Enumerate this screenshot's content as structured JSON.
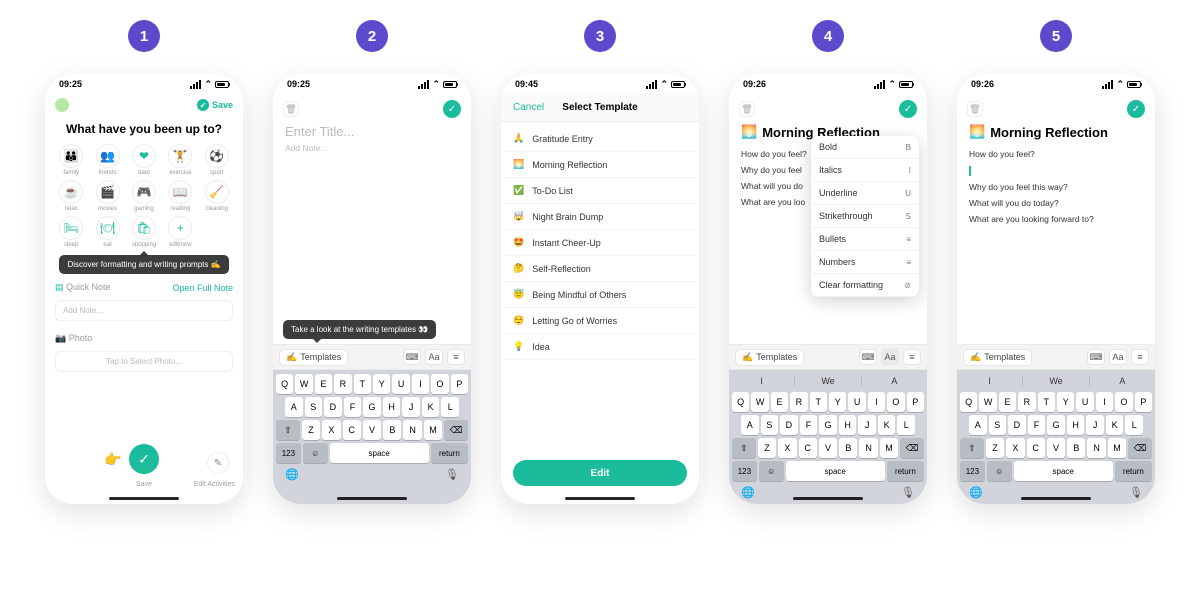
{
  "badges": [
    "1",
    "2",
    "3",
    "4",
    "5"
  ],
  "status": {
    "t1": "09:25",
    "t2": "09:25",
    "t3": "09:45",
    "t4": "09:26",
    "t5": "09:26"
  },
  "s1": {
    "save": "Save",
    "heading": "What have you been up to?",
    "activities": [
      {
        "name": "family",
        "icon": "👪"
      },
      {
        "name": "friends",
        "icon": "👥"
      },
      {
        "name": "date",
        "icon": "❤"
      },
      {
        "name": "exercise",
        "icon": "🏋"
      },
      {
        "name": "sport",
        "icon": "⚽"
      },
      {
        "name": "relax",
        "icon": "☕"
      },
      {
        "name": "movies",
        "icon": "🎬"
      },
      {
        "name": "gaming",
        "icon": "🎮"
      },
      {
        "name": "reading",
        "icon": "📖"
      },
      {
        "name": "cleaning",
        "icon": "🧹"
      },
      {
        "name": "sleep",
        "icon": "🛏"
      },
      {
        "name": "eat",
        "icon": "🍽"
      },
      {
        "name": "shopping",
        "icon": "🛍"
      },
      {
        "name": "edit/new",
        "icon": "+"
      }
    ],
    "tooltip": "Discover formatting and writing prompts ✍️",
    "quicknote": "Quick Note",
    "openfull": "Open Full Note",
    "addnote": "Add Note...",
    "photo": "Photo",
    "tapphoto": "Tap to Select Photo...",
    "savelbl": "Save",
    "editact": "Edit Activities"
  },
  "s2": {
    "title_ph": "Enter Title...",
    "body_ph": "Add Note...",
    "templates": "Templates",
    "tooltip": "Take a look at the writing templates 👀",
    "keyboard": {
      "row1": [
        "Q",
        "W",
        "E",
        "R",
        "T",
        "Y",
        "U",
        "I",
        "O",
        "P"
      ],
      "row2": [
        "A",
        "S",
        "D",
        "F",
        "G",
        "H",
        "J",
        "K",
        "L"
      ],
      "row3": [
        "Z",
        "X",
        "C",
        "V",
        "B",
        "N",
        "M"
      ],
      "k123": "123",
      "space": "space",
      "return": "return"
    }
  },
  "s3": {
    "cancel": "Cancel",
    "title": "Select Template",
    "items": [
      {
        "e": "🙏",
        "t": "Gratitude Entry"
      },
      {
        "e": "🌅",
        "t": "Morning Reflection"
      },
      {
        "e": "✅",
        "t": "To-Do List"
      },
      {
        "e": "🤯",
        "t": "Night Brain Dump"
      },
      {
        "e": "🤩",
        "t": "Instant Cheer-Up"
      },
      {
        "e": "🤔",
        "t": "Self-Reflection"
      },
      {
        "e": "😇",
        "t": "Being Mindful of Others"
      },
      {
        "e": "😌",
        "t": "Letting Go of Worries"
      },
      {
        "e": "💡",
        "t": "Idea"
      }
    ],
    "edit": "Edit"
  },
  "s4": {
    "title": "Morning Reflection",
    "emoji": "🌅",
    "prompts": [
      "How do you feel?",
      "Why do you feel",
      "What will you do",
      "What are you loo"
    ],
    "templates": "Templates",
    "menu": [
      {
        "l": "Bold",
        "s": "B"
      },
      {
        "l": "Italics",
        "s": "I"
      },
      {
        "l": "Underline",
        "s": "U"
      },
      {
        "l": "Strikethrough",
        "s": "S"
      },
      {
        "l": "Bullets",
        "s": "≡"
      },
      {
        "l": "Numbers",
        "s": "≡"
      },
      {
        "l": "Clear formatting",
        "s": "⊘"
      }
    ],
    "sug": [
      "I",
      "We",
      "A"
    ]
  },
  "s5": {
    "title": "Morning Reflection",
    "emoji": "🌅",
    "prompts": [
      "How do you feel?",
      "Why do you feel this way?",
      "What will you do today?",
      "What are you looking forward to?"
    ],
    "templates": "Templates",
    "sug": [
      "I",
      "We",
      "A"
    ]
  }
}
